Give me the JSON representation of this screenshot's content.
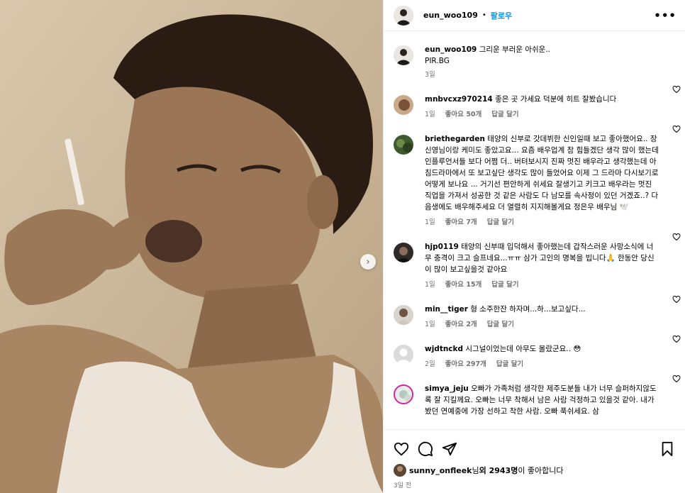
{
  "post": {
    "author": "eun_woo109",
    "separator": "•",
    "follow_label": "팔로우",
    "more_icon": "more-horizontal-icon",
    "caption_text": "그리운 부러운 아쉬운..",
    "caption_line2": "PIR.BG",
    "caption_time": "3일"
  },
  "comments": [
    {
      "user": "mnbvcxz970214",
      "text": "좋은 곳 가세요 덕분에 히트 잘봤습니다",
      "time": "1일",
      "likes": "좋아요 50개",
      "reply": "답글 달기"
    },
    {
      "user": "briethegarden",
      "text": "태양의 신부로 갓데뷔한 신인일때 보고 좋아했어요.. 장신영님이랑 케미도 좋았고요... 요즘 배우업계 참 힘들겠단 생각 많이 했는데 인플루언서들 보다 어쩜 더.. 버텨보시지 진짜 멋진 배우라고 생각했는데 아침드라마에서 또 보고싶단 생각도 많이 들었어요 이제 그 드라마 다시보기로 어떻게 보나요 ... 거기선 편안하게 쉬세요 잘생기고 키크고 배우라는 멋진 직업을 가져서 성공한 것 같은 사람도 다 남모를 속사정이 있던 거겠죠..? 다음생에도 배우해주세요 더 열렬히 지지해볼게요 정은우 배우님 🕊️",
      "time": "1일",
      "likes": "좋아요 7개",
      "reply": "답글 달기"
    },
    {
      "user": "hjp0119",
      "text": "태양의 신부때 입덕해서 좋아했는데 갑작스러운 사망소식에 너무 충격이 크고 슬프네요...ㅠㅠ 삼가 고인의 명복을 빕니다🙏 한동안 당신이 많이 보고싶을것 같아요",
      "time": "1일",
      "likes": "좋아요 15개",
      "reply": "답글 달기"
    },
    {
      "user": "min__tiger",
      "text": "형 소주한잔 하자며...하...보고싶다...",
      "time": "1일",
      "likes": "좋아요 2개",
      "reply": "답글 달기"
    },
    {
      "user": "wjdtnckd",
      "text": "시그널이었는데 아무도 몰랐군요.. 😳",
      "time": "2일",
      "likes": "좋아요 297개",
      "reply": "답글 달기"
    },
    {
      "user": "simya_jeju",
      "text": "오빠가 가족처럼 생각한 제주도분들 내가 너무 슬퍼하지않도록 잘 지킬께요. 오빠는 너무 착해서 남은 사람 걱정하고 있을것 같아. 내가 봤던 연예중에 가장 선하고 착한 사람. 오빠 푹쉬세요. 삼",
      "time": "",
      "likes": "",
      "reply": ""
    }
  ],
  "actions": {
    "like_icon": "heart-icon",
    "comment_icon": "comment-icon",
    "share_icon": "share-icon",
    "save_icon": "bookmark-icon"
  },
  "likes_summary": {
    "user": "sunny_onfleek",
    "suffix1": "님 ",
    "others": "외 2943명",
    "suffix2": "이 좋아합니다"
  },
  "posted_ago": "3일 전",
  "media": {
    "next_icon": "chevron-right-icon"
  }
}
